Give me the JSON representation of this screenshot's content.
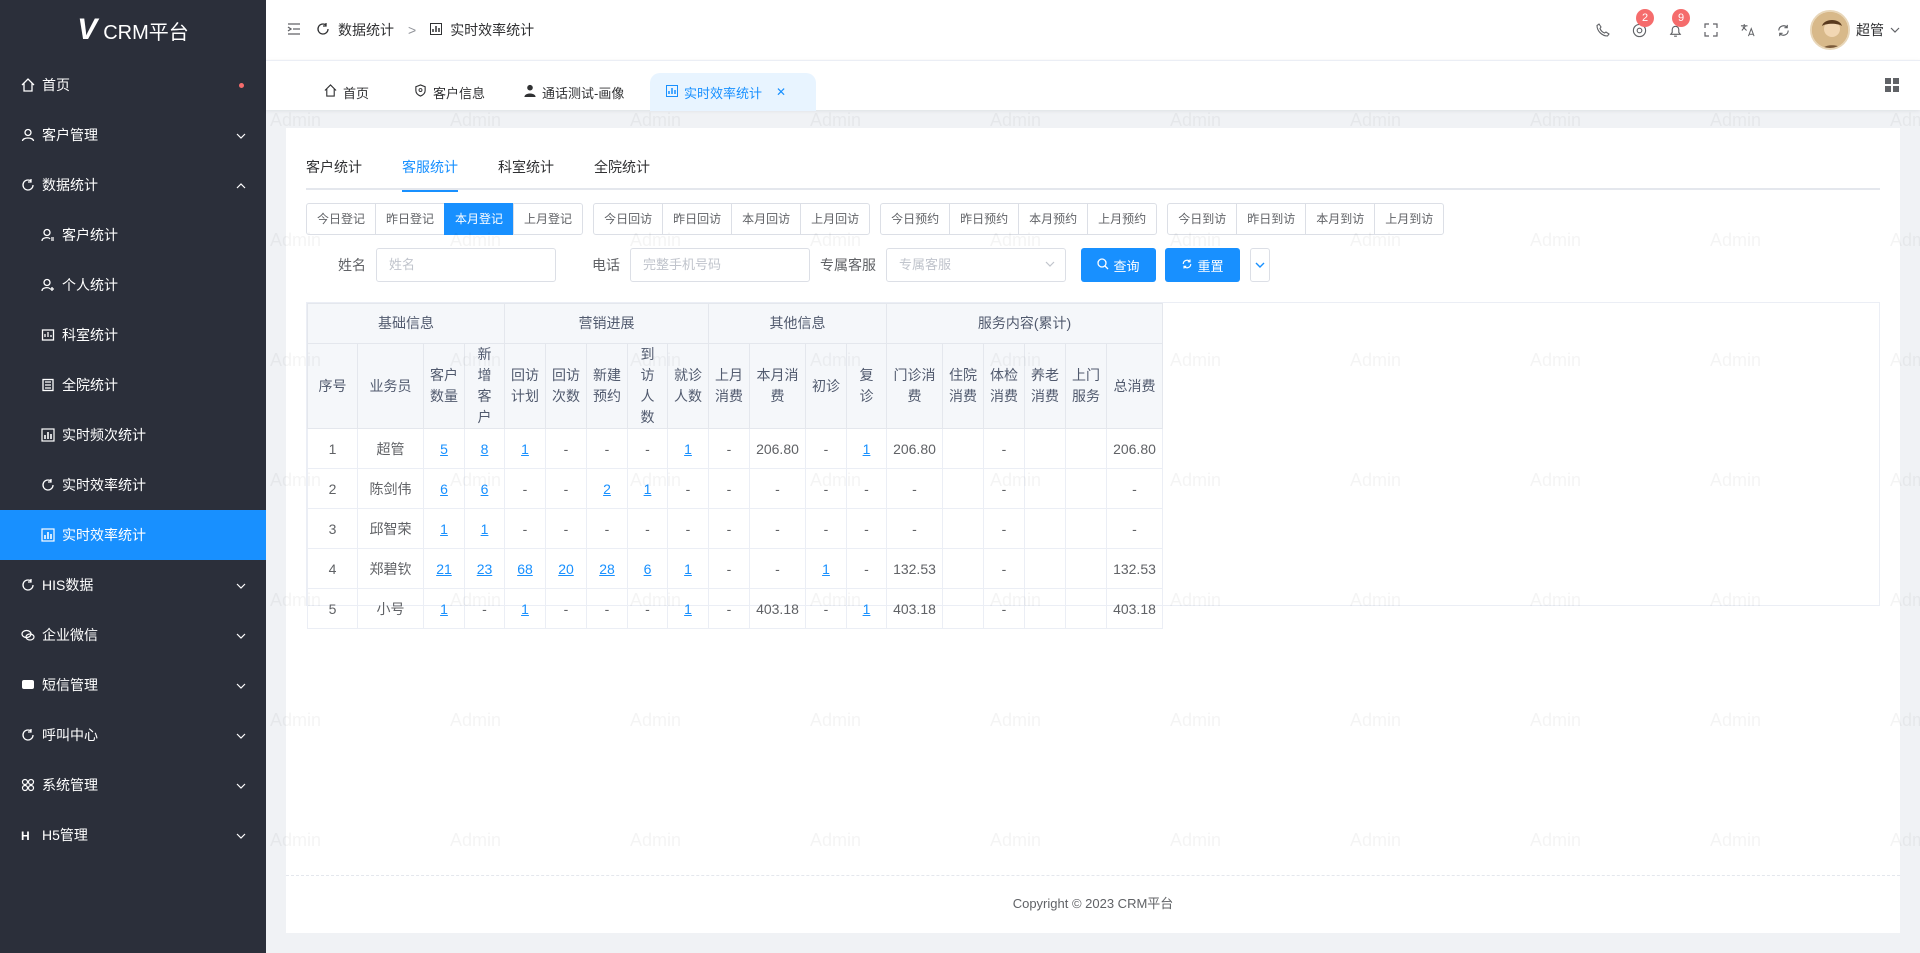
{
  "app": {
    "logo_text": "CRM平台"
  },
  "sidebar": {
    "items": [
      {
        "label": "首页",
        "icon": "home-icon"
      },
      {
        "label": "客户管理",
        "icon": "user-icon"
      },
      {
        "label": "数据统计",
        "icon": "stats-icon"
      },
      {
        "label": "客户统计",
        "icon": "user-stat-icon"
      },
      {
        "label": "个人统计",
        "icon": "person-icon"
      },
      {
        "label": "科室统计",
        "icon": "department-icon"
      },
      {
        "label": "全院统计",
        "icon": "hospital-icon"
      },
      {
        "label": "实时频次统计",
        "icon": "chart-icon"
      },
      {
        "label": "实时效率统计",
        "icon": "refresh-icon"
      },
      {
        "label": "实时效率统计",
        "icon": "chart-icon"
      },
      {
        "label": "HIS数据",
        "icon": "his-icon"
      },
      {
        "label": "企业微信",
        "icon": "wechat-icon"
      },
      {
        "label": "短信管理",
        "icon": "message-icon"
      },
      {
        "label": "呼叫中心",
        "icon": "call-icon"
      },
      {
        "label": "系统管理",
        "icon": "settings-icon"
      },
      {
        "label": "H5管理",
        "icon": "h5-icon"
      }
    ]
  },
  "header": {
    "breadcrumb": [
      "数据统计",
      "实时效率统计"
    ],
    "badges": {
      "at": "2",
      "bell": "9"
    },
    "user_name": "超管"
  },
  "tabs": [
    "首页",
    "客户信息",
    "通话测试-画像",
    "实时效率统计"
  ],
  "subtabs": [
    "客户统计",
    "客服统计",
    "科室统计",
    "全院统计"
  ],
  "button_groups": [
    [
      "今日登记",
      "昨日登记",
      "本月登记",
      "上月登记"
    ],
    [
      "今日回访",
      "昨日回访",
      "本月回访",
      "上月回访"
    ],
    [
      "今日预约",
      "昨日预约",
      "本月预约",
      "上月预约"
    ],
    [
      "今日到访",
      "昨日到访",
      "本月到访",
      "上月到访"
    ]
  ],
  "filters": {
    "name_label": "姓名",
    "name_placeholder": "姓名",
    "phone_label": "电话",
    "phone_placeholder": "完整手机号码",
    "service_label": "专属客服",
    "service_placeholder": "专属客服",
    "search_label": "查询",
    "reset_label": "重置"
  },
  "table": {
    "groups": [
      "基础信息",
      "营销进展",
      "其他信息",
      "服务内容(累计)"
    ],
    "columns": [
      "序号",
      "业务员",
      "客户数量",
      "新增客户",
      "回访计划",
      "回访次数",
      "新建预约",
      "到访人数",
      "就诊人数",
      "上月消费",
      "本月消费",
      "初诊",
      "复诊",
      "门诊消费",
      "住院消费",
      "体检消费",
      "养老消费",
      "上门服务",
      "总消费"
    ],
    "rows": [
      [
        "1",
        "超管",
        "5",
        "8",
        "1",
        "-",
        "-",
        "-",
        "1",
        "-",
        "206.80",
        "-",
        "1",
        "206.80",
        "",
        "-",
        "",
        "",
        "206.80"
      ],
      [
        "2",
        "陈剑伟",
        "6",
        "6",
        "-",
        "-",
        "2",
        "1",
        "-",
        "-",
        "-",
        "-",
        "-",
        "-",
        "",
        "-",
        "",
        "",
        "-"
      ],
      [
        "3",
        "邱智荣",
        "1",
        "1",
        "-",
        "-",
        "-",
        "-",
        "-",
        "-",
        "-",
        "-",
        "-",
        "-",
        "",
        "-",
        "",
        "",
        "-"
      ],
      [
        "4",
        "郑碧钦",
        "21",
        "23",
        "68",
        "20",
        "28",
        "6",
        "1",
        "-",
        "-",
        "1",
        "-",
        "132.53",
        "",
        "-",
        "",
        "",
        "132.53"
      ],
      [
        "5",
        "小号",
        "1",
        "-",
        "1",
        "-",
        "-",
        "-",
        "1",
        "-",
        "403.18",
        "-",
        "1",
        "403.18",
        "",
        "-",
        "",
        "",
        "403.18"
      ]
    ]
  },
  "footer": "Copyright © 2023 CRM平台",
  "watermark": "Admin",
  "colors": {
    "primary": "#1890ff",
    "sidebar": "#2b2f3a",
    "badge": "#f56c6c"
  }
}
